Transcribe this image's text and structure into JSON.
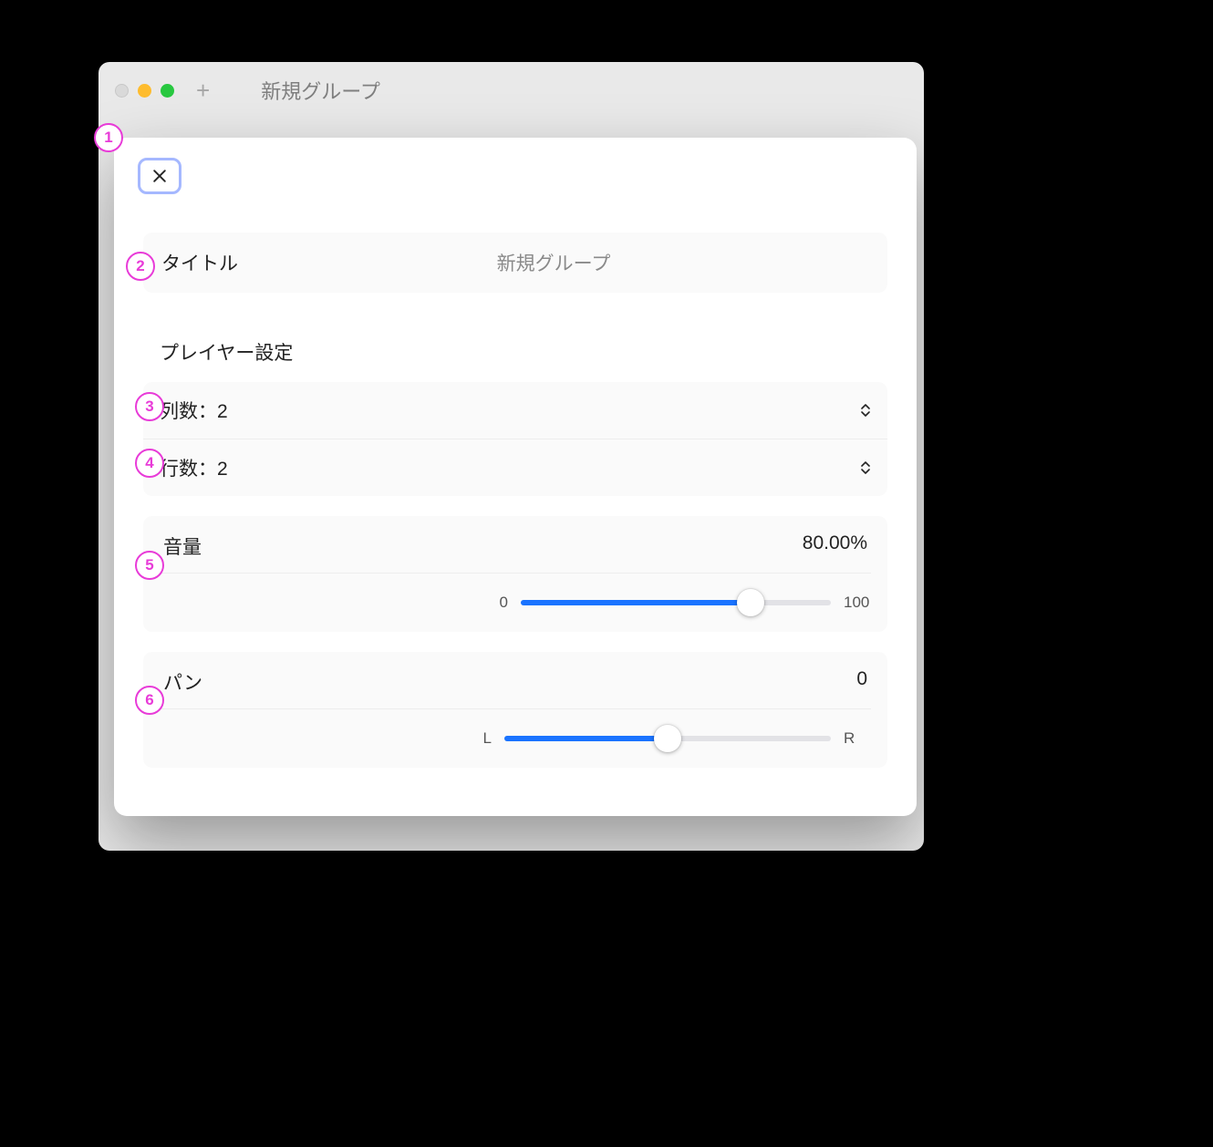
{
  "window": {
    "title": "新規グループ"
  },
  "modal": {
    "title_label": "タイトル",
    "title_value": "新規グループ",
    "section_player": "プレイヤー設定",
    "columns_label": "列数：2",
    "rows_label": "行数：2",
    "volume": {
      "label": "音量",
      "value": "80.00%",
      "min": "0",
      "max": "100"
    },
    "pan": {
      "label": "パン",
      "value": "0",
      "left": "L",
      "right": "R"
    }
  },
  "annotations": [
    "1",
    "2",
    "3",
    "4",
    "5",
    "6"
  ]
}
